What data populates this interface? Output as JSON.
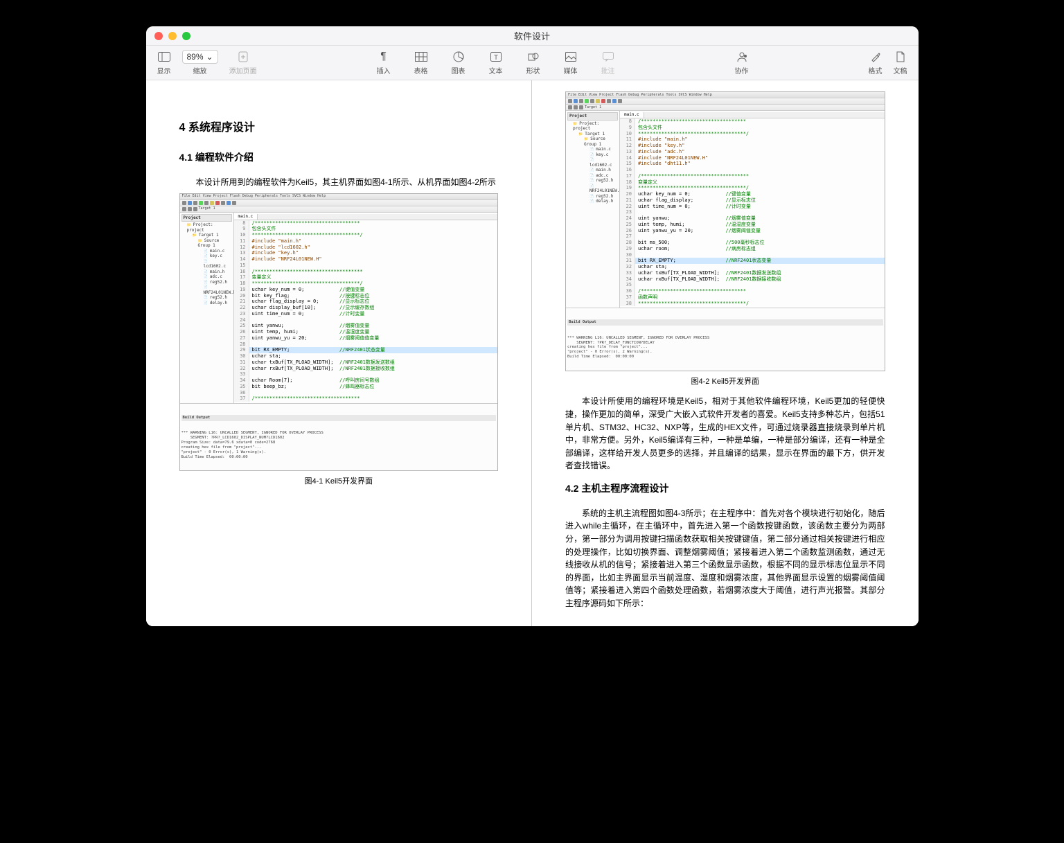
{
  "window": {
    "title": "软件设计"
  },
  "toolbar": {
    "view": "显示",
    "zoom": "缩放",
    "zoom_value": "89%",
    "add_page": "添加页面",
    "insert": "插入",
    "table": "表格",
    "chart": "图表",
    "text": "文本",
    "shape": "形状",
    "media": "媒体",
    "comment": "批注",
    "collaborate": "协作",
    "format": "格式",
    "document": "文稿"
  },
  "doc": {
    "h1": "4 系统程序设计",
    "h2a": "4.1 编程软件介绍",
    "intro_left": "本设计所用到的编程软件为Keil5，其主机界面如图4-1所示、从机界面如图4-2所示",
    "fig1_caption": "图4-1 Keil5开发界面",
    "fig2_caption": "图4-2 Keil5开发界面",
    "para_right1": "本设计所使用的编程环境是Keil5，相对于其他软件编程环境，Keil5更加的轻便快捷，操作更加的简单，深受广大嵌入式软件开发者的喜爱。Keil5支持多种芯片，包括51单片机、STM32、HC32、NXP等，生成的HEX文件，可通过烧录器直接烧录到单片机中，非常方便。另外，Keil5编译有三种，一种是单编，一种是部分编译，还有一种是全部编译，这样给开发人员更多的选择，并且编译的结果，显示在界面的最下方，供开发者查找错误。",
    "h2b": "4.2 主机主程序流程设计",
    "para_right2": "系统的主机主流程图如图4-3所示；在主程序中：首先对各个模块进行初始化，随后进入while主循环，在主循环中，首先进入第一个函数按键函数，该函数主要分为两部分，第一部分为调用按键扫描函数获取相关按键键值，第二部分通过相关按键进行相应的处理操作，比如切换界面、调整烟雾阈值；紧接着进入第二个函数监测函数，通过无线接收从机的信号；紧接着进入第三个函数显示函数，根据不同的显示标志位显示不同的界面，比如主界面显示当前温度、湿度和烟雾浓度，其他界面显示设置的烟雾阈值阈值等；紧接着进入第四个函数处理函数，若烟雾浓度大于阈值，进行声光报警。其部分主程序源码如下所示："
  },
  "ide": {
    "menu": "File  Edit  View  Project  Flash  Debug  Peripherals  Tools  SVCS  Window  Help",
    "project_title": "Project",
    "tree": {
      "root": "Project: project",
      "target": "Target 1",
      "group": "Source Group 1",
      "files": [
        "main.c",
        "key.c",
        "lcd1602.c",
        "main.h",
        "adc.c",
        "reg52.h",
        "NRF24L01NEW.h",
        "reg52.h",
        "delay.h"
      ]
    },
    "code_tab": "main.c",
    "output_title": "Build Output",
    "left_lines": [
      {
        "n": 8,
        "t": "/************************************",
        "c": "green"
      },
      {
        "n": 9,
        "t": "包含头文件",
        "c": "green"
      },
      {
        "n": 10,
        "t": "*************************************/",
        "c": "green"
      },
      {
        "n": 11,
        "t": "#include \"main.h\"",
        "c": "brown",
        "pre": "#include "
      },
      {
        "n": 12,
        "t": "#include \"lcd1602.h\"",
        "c": "brown"
      },
      {
        "n": 13,
        "t": "#include \"key.h\"",
        "c": "brown"
      },
      {
        "n": 14,
        "t": "#include \"NRF24L01NEW.H\"",
        "c": "brown"
      },
      {
        "n": 15,
        "t": "",
        "c": ""
      },
      {
        "n": 16,
        "t": "/*************************************",
        "c": "green"
      },
      {
        "n": 17,
        "t": "变量定义",
        "c": "green"
      },
      {
        "n": 18,
        "t": "*************************************/",
        "c": "green"
      },
      {
        "n": 19,
        "t": "uchar key_num = 0;",
        "cm": "//键值变量"
      },
      {
        "n": 20,
        "t": "bit key_flag;",
        "cm": "//按键标志位"
      },
      {
        "n": 21,
        "t": "uchar flag_display = 0;",
        "cm": "//显示标志位"
      },
      {
        "n": 22,
        "t": "uchar display_buf[10];",
        "cm": "//显示缓存数组"
      },
      {
        "n": 23,
        "t": "uint time_num = 0;",
        "cm": "//计时变量"
      },
      {
        "n": 24,
        "t": "",
        "c": ""
      },
      {
        "n": 25,
        "t": "uint yanwu;",
        "cm": "//烟雾值变量"
      },
      {
        "n": 26,
        "t": "uint temp, humi;",
        "cm": "//温湿度变量"
      },
      {
        "n": 27,
        "t": "uint yanwu_yu = 20;",
        "cm": "//烟雾阈值值变量"
      },
      {
        "n": 28,
        "t": "",
        "c": ""
      },
      {
        "n": 29,
        "t": "bit RX_EMPTY;",
        "cm": "//NRF2401状态变量",
        "hl": true
      },
      {
        "n": 30,
        "t": "uchar sta;",
        "c": ""
      },
      {
        "n": 31,
        "t": "uchar txBuf[TX_PLOAD_WIDTH];",
        "cm": "//NRF2401数据发送数组"
      },
      {
        "n": 32,
        "t": "uchar rxBuf[TX_PLOAD_WIDTH];",
        "cm": "//NRF2401数据接收数组"
      },
      {
        "n": 33,
        "t": "",
        "c": ""
      },
      {
        "n": 34,
        "t": "uchar Room[7];",
        "cm": "//呼叫房间号数组"
      },
      {
        "n": 35,
        "t": "bit beep_bz;",
        "cm": "//蜂鸣器标志位"
      },
      {
        "n": 36,
        "t": "",
        "c": ""
      },
      {
        "n": 37,
        "t": "/************************************",
        "c": "green"
      }
    ],
    "right_lines": [
      {
        "n": 8,
        "t": "/************************************",
        "c": "green"
      },
      {
        "n": 9,
        "t": "包含头文件",
        "c": "green"
      },
      {
        "n": 10,
        "t": "*************************************/",
        "c": "green"
      },
      {
        "n": 11,
        "t": "#include \"main.h\"",
        "c": "brown"
      },
      {
        "n": 12,
        "t": "#include \"key.h\"",
        "c": "brown"
      },
      {
        "n": 13,
        "t": "#include \"adc.h\"",
        "c": "brown"
      },
      {
        "n": 14,
        "t": "#include \"NRF24L01NEW.H\"",
        "c": "brown"
      },
      {
        "n": 15,
        "t": "#include \"dht11.h\"",
        "c": "brown"
      },
      {
        "n": 16,
        "t": "",
        "c": ""
      },
      {
        "n": 17,
        "t": "/*************************************",
        "c": "green"
      },
      {
        "n": 18,
        "t": "变量定义",
        "c": "green"
      },
      {
        "n": 19,
        "t": "*************************************/",
        "c": "green"
      },
      {
        "n": 20,
        "t": "uchar key_num = 0;",
        "cm": "//键值变量"
      },
      {
        "n": 21,
        "t": "uchar flag_display;",
        "cm": "//显示标志位"
      },
      {
        "n": 22,
        "t": "uint time_num = 0;",
        "cm": "//计时变量"
      },
      {
        "n": 23,
        "t": "",
        "c": ""
      },
      {
        "n": 24,
        "t": "uint yanwu;",
        "cm": "//烟雾值变量"
      },
      {
        "n": 25,
        "t": "uint temp, humi;",
        "cm": "//温湿度变量"
      },
      {
        "n": 26,
        "t": "uint yanwu_yu = 20;",
        "cm": "//烟雾阈值变量"
      },
      {
        "n": 27,
        "t": "",
        "c": ""
      },
      {
        "n": 28,
        "t": "bit ms_500;",
        "cm": "//500毫秒标志位"
      },
      {
        "n": 29,
        "t": "uchar room;",
        "cm": "//病房标志组"
      },
      {
        "n": 30,
        "t": "",
        "c": ""
      },
      {
        "n": 31,
        "t": "bit RX_EMPTY;",
        "cm": "//NRF2401状态变量",
        "hl": true
      },
      {
        "n": 32,
        "t": "uchar sta;",
        "c": ""
      },
      {
        "n": 33,
        "t": "uchar txBuf[TX_PLOAD_WIDTH];",
        "cm": "//NRF2401数据发送数组"
      },
      {
        "n": 34,
        "t": "uchar rxBuf[TX_PLOAD_WIDTH];",
        "cm": "//NRF2401数据接收数组"
      },
      {
        "n": 35,
        "t": "",
        "c": ""
      },
      {
        "n": 36,
        "t": "/************************************",
        "c": "green"
      },
      {
        "n": 37,
        "t": "函数声明",
        "c": "green"
      },
      {
        "n": 38,
        "t": "*************************************/",
        "c": "green"
      }
    ],
    "output_left": "*** WARNING L16: UNCALLED SEGMENT, IGNORED FOR OVERLAY PROCESS\n    SEGMENT: ?PR?_LCD1602_DISPLAY_NUM?LCD1602\nProgram Size: data=79.6 xdata=0 code=2768\ncreating hex file from \"project\"...\n\"project\" - 0 Error(s), 1 Warning(s).\nBuild Time Elapsed:  00:00:00",
    "output_right": "*** WARNING L16: UNCALLED SEGMENT, IGNORED FOR OVERLAY PROCESS\n    SEGMENT: ?PR?_DELAY_FUNCTION?DELAY\ncreating hex file from \"project\"...\n\"project\" - 0 Error(s), 2 Warning(s).\nBuild Time Elapsed:  00:00:00"
  }
}
